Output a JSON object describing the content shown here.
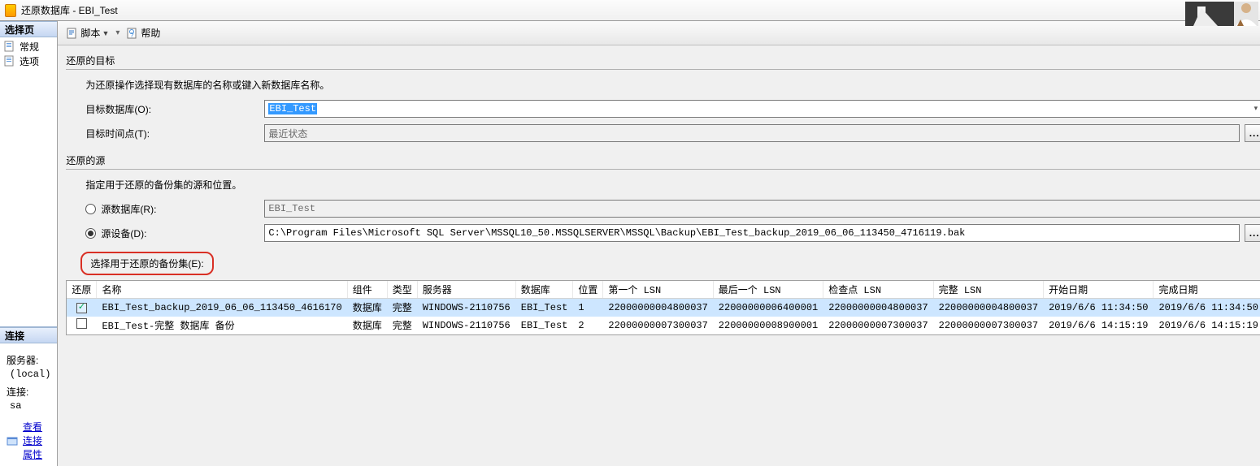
{
  "window": {
    "title": "还原数据库 - EBI_Test"
  },
  "sidebar": {
    "header": "选择页",
    "items": [
      {
        "label": "常规"
      },
      {
        "label": "选项"
      }
    ],
    "conn_header": "连接",
    "server_label": "服务器:",
    "server_value": "(local)",
    "conn_label": "连接:",
    "conn_value": "sa",
    "view_props": "查看连接属性"
  },
  "toolbar": {
    "script": "脚本",
    "help": "帮助"
  },
  "dest": {
    "title": "还原的目标",
    "desc": "为还原操作选择现有数据库的名称或键入新数据库名称。",
    "db_label": "目标数据库(O):",
    "db_value": "EBI_Test",
    "time_label": "目标时间点(T):",
    "time_value": "最近状态"
  },
  "source": {
    "title": "还原的源",
    "desc": "指定用于还原的备份集的源和位置。",
    "radio_db": "源数据库(R):",
    "radio_db_value": "EBI_Test",
    "radio_dev": "源设备(D):",
    "radio_dev_value": "C:\\Program Files\\Microsoft SQL Server\\MSSQL10_50.MSSQLSERVER\\MSSQL\\Backup\\EBI_Test_backup_2019_06_06_113450_4716119.bak",
    "select_sets": "选择用于还原的备份集(E):"
  },
  "table": {
    "cols": [
      "还原",
      "名称",
      "组件",
      "类型",
      "服务器",
      "数据库",
      "位置",
      "第一个 LSN",
      "最后一个 LSN",
      "检查点 LSN",
      "完整 LSN",
      "开始日期",
      "完成日期"
    ],
    "rows": [
      {
        "chk": true,
        "name": "EBI_Test_backup_2019_06_06_113450_4616170",
        "comp": "数据库",
        "type": "完整",
        "server": "WINDOWS-2110756",
        "db": "EBI_Test",
        "pos": "1",
        "lsn1": "22000000004800037",
        "lsn2": "22000000006400001",
        "lsn3": "22000000004800037",
        "lsn4": "22000000004800037",
        "start": "2019/6/6 11:34:50",
        "end": "2019/6/6 11:34:50"
      },
      {
        "chk": false,
        "name": "EBI_Test-完整 数据库 备份",
        "comp": "数据库",
        "type": "完整",
        "server": "WINDOWS-2110756",
        "db": "EBI_Test",
        "pos": "2",
        "lsn1": "22000000007300037",
        "lsn2": "22000000008900001",
        "lsn3": "22000000007300037",
        "lsn4": "22000000007300037",
        "start": "2019/6/6 14:15:19",
        "end": "2019/6/6 14:15:19"
      }
    ]
  },
  "dots": "..."
}
